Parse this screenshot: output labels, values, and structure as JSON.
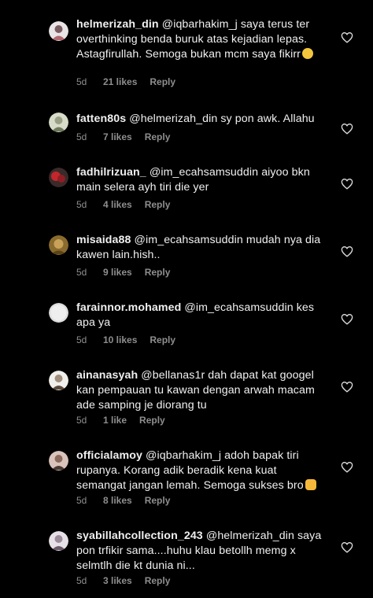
{
  "comments": [
    {
      "username": "helmerizah_din",
      "text": "@iqbarhakim_j saya terus ter overthinking benda buruk atas kejadian lepas. Astagfirullah. Semoga bukan mcm saya fikirr",
      "emoji": "crying-face",
      "time": "5d",
      "likes": "21 likes",
      "reply": "Reply"
    },
    {
      "username": "fatten80s",
      "text": "@helmerizah_din sy pon awk. Allahu",
      "time": "5d",
      "likes": "7 likes",
      "reply": "Reply"
    },
    {
      "username": "fadhilrizuan_",
      "text": "@im_ecahsamsuddin aiyoo bkn main selera ayh tiri die yer",
      "time": "5d",
      "likes": "4 likes",
      "reply": "Reply"
    },
    {
      "username": "misaida88",
      "text": "@im_ecahsamsuddin mudah nya dia kawen lain.hish..",
      "time": "5d",
      "likes": "9 likes",
      "reply": "Reply"
    },
    {
      "username": "farainnor.mohamed",
      "text": "@im_ecahsamsuddin kes apa ya",
      "time": "5d",
      "likes": "10 likes",
      "reply": "Reply"
    },
    {
      "username": "ainanasyah",
      "text": "@bellanas1r dah dapat kat googel kan pempauan tu kawan dengan arwah macam ade samping je diorang tu",
      "time": "5d",
      "likes": "1 like",
      "reply": "Reply"
    },
    {
      "username": "officialamoy",
      "text": "@iqbarhakim_j adoh bapak tiri rupanya. Korang adik beradik kena kuat semangat jangan lemah. Semoga sukses bro",
      "emoji": "clapping-hands",
      "time": "5d",
      "likes": "8 likes",
      "reply": "Reply"
    },
    {
      "username": "syabillahcollection_243",
      "text": "@helmerizah_din saya pon trfikir sama....huhu klau betollh memg x selmtlh die kt dunia ni...",
      "time": "5d",
      "likes": "3 likes",
      "reply": "Reply"
    }
  ],
  "colors": {
    "background": "#000000",
    "text": "#f0f0f0",
    "meta": "#8e8e8e"
  }
}
